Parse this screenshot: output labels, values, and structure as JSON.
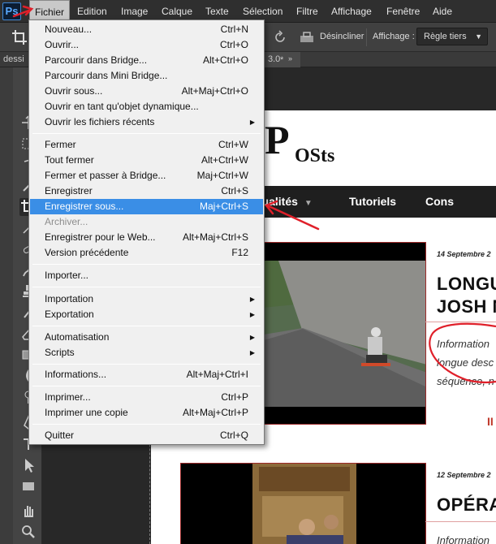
{
  "app": {
    "logo": "Ps"
  },
  "menubar": {
    "items": [
      "Fichier",
      "Edition",
      "Image",
      "Calque",
      "Texte",
      "Sélection",
      "Filtre",
      "Affichage",
      "Fenêtre",
      "Aide"
    ]
  },
  "options": {
    "straighten_label": "Désincliner",
    "view_label": "Affichage :",
    "view_value": "Règle tiers"
  },
  "tabs": {
    "left": "dessi",
    "right": "3.0"
  },
  "fichier_menu": [
    {
      "label": "Nouveau...",
      "shortcut": "Ctrl+N"
    },
    {
      "label": "Ouvrir...",
      "shortcut": "Ctrl+O"
    },
    {
      "label": "Parcourir dans Bridge...",
      "shortcut": "Alt+Ctrl+O"
    },
    {
      "label": "Parcourir dans Mini Bridge...",
      "shortcut": ""
    },
    {
      "label": "Ouvrir sous...",
      "shortcut": "Alt+Maj+Ctrl+O"
    },
    {
      "label": "Ouvrir en tant qu'objet dynamique...",
      "shortcut": ""
    },
    {
      "label": "Ouvrir les fichiers récents",
      "shortcut": ""
    },
    {
      "label": "Fermer",
      "shortcut": "Ctrl+W"
    },
    {
      "label": "Tout fermer",
      "shortcut": "Alt+Ctrl+W"
    },
    {
      "label": "Fermer et passer à Bridge...",
      "shortcut": "Maj+Ctrl+W"
    },
    {
      "label": "Enregistrer",
      "shortcut": "Ctrl+S"
    },
    {
      "label": "Enregistrer sous...",
      "shortcut": "Maj+Ctrl+S"
    },
    {
      "label": "Archiver...",
      "shortcut": ""
    },
    {
      "label": "Enregistrer pour le Web...",
      "shortcut": "Alt+Maj+Ctrl+S"
    },
    {
      "label": "Version précédente",
      "shortcut": "F12"
    },
    {
      "label": "Importer...",
      "shortcut": ""
    },
    {
      "label": "Importation",
      "shortcut": ""
    },
    {
      "label": "Exportation",
      "shortcut": ""
    },
    {
      "label": "Automatisation",
      "shortcut": ""
    },
    {
      "label": "Scripts",
      "shortcut": ""
    },
    {
      "label": "Informations...",
      "shortcut": "Alt+Maj+Ctrl+I"
    },
    {
      "label": "Imprimer...",
      "shortcut": "Ctrl+P"
    },
    {
      "label": "Imprimer une copie",
      "shortcut": "Alt+Maj+Ctrl+P"
    },
    {
      "label": "Quitter",
      "shortcut": "Ctrl+Q"
    }
  ],
  "site": {
    "logo_big": "P",
    "logo_small": "OSts",
    "nav": [
      "Actualités",
      "Tutoriels",
      "Cons"
    ],
    "articles": [
      {
        "date": "14 Septembre 2",
        "title_1": "LONGU",
        "title_2": "JOSH N",
        "text_1": "Information",
        "text_2": "longue desc",
        "text_3": "séquence, n",
        "more": "II"
      },
      {
        "date": "12 Septembre 2",
        "title_1": "OPÉRA",
        "text_1": "Information"
      }
    ]
  },
  "colors": {
    "highlight": "#3a8ee6",
    "annotation": "#e0202a",
    "menubar": "#2f2f2f"
  }
}
